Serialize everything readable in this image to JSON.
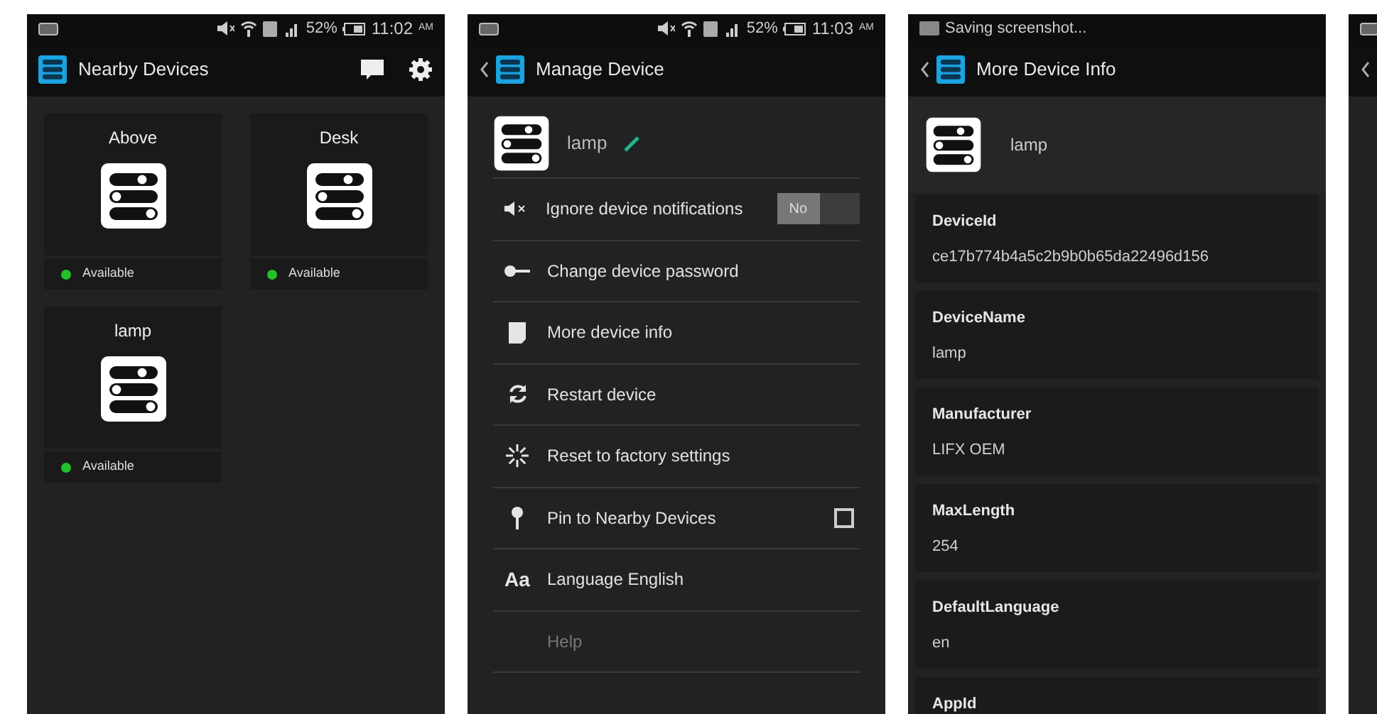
{
  "screens": [
    {
      "kind": "grid",
      "status": {
        "battery": "52%",
        "time": "11:02",
        "ampm": "AM"
      },
      "back": false,
      "title": "Nearby Devices",
      "devices": [
        {
          "name": "Above",
          "status": "Available",
          "color": "#22c02a"
        },
        {
          "name": "Desk",
          "status": "Available",
          "color": "#22c02a"
        },
        {
          "name": "lamp",
          "status": "Available",
          "color": "#22c02a"
        }
      ]
    },
    {
      "kind": "manage",
      "status": {
        "battery": "52%",
        "time": "11:03",
        "ampm": "AM"
      },
      "back": true,
      "title": "Manage Device",
      "device_name": "lamp",
      "items": [
        {
          "kind": "toggle",
          "label": "Ignore device notifications",
          "toggle_text": "No",
          "on": false
        },
        {
          "kind": "plain",
          "label": "Change device password"
        },
        {
          "kind": "plain",
          "label": "More device info"
        },
        {
          "kind": "plain",
          "label": "Restart device"
        },
        {
          "kind": "plain",
          "label": "Reset to factory settings"
        },
        {
          "kind": "checkbox",
          "label": "Pin to Nearby Devices",
          "checked": false
        },
        {
          "kind": "plain",
          "icon_text": "Aa",
          "label": "Language English"
        },
        {
          "kind": "disabled",
          "label": "Help"
        }
      ]
    },
    {
      "kind": "info",
      "status": {
        "notification": "Saving screenshot..."
      },
      "back": true,
      "title": "More Device Info",
      "device_name": "lamp",
      "fields": [
        {
          "label": "DeviceId",
          "value": "ce17b774b4a5c2b9b0b65da22496d156"
        },
        {
          "label": "DeviceName",
          "value": "lamp"
        },
        {
          "label": "Manufacturer",
          "value": "LIFX OEM"
        },
        {
          "label": "MaxLength",
          "value": "254"
        },
        {
          "label": "DefaultLanguage",
          "value": "en"
        },
        {
          "label": "AppId"
        }
      ]
    },
    {
      "kind": "blank",
      "back": true
    }
  ]
}
